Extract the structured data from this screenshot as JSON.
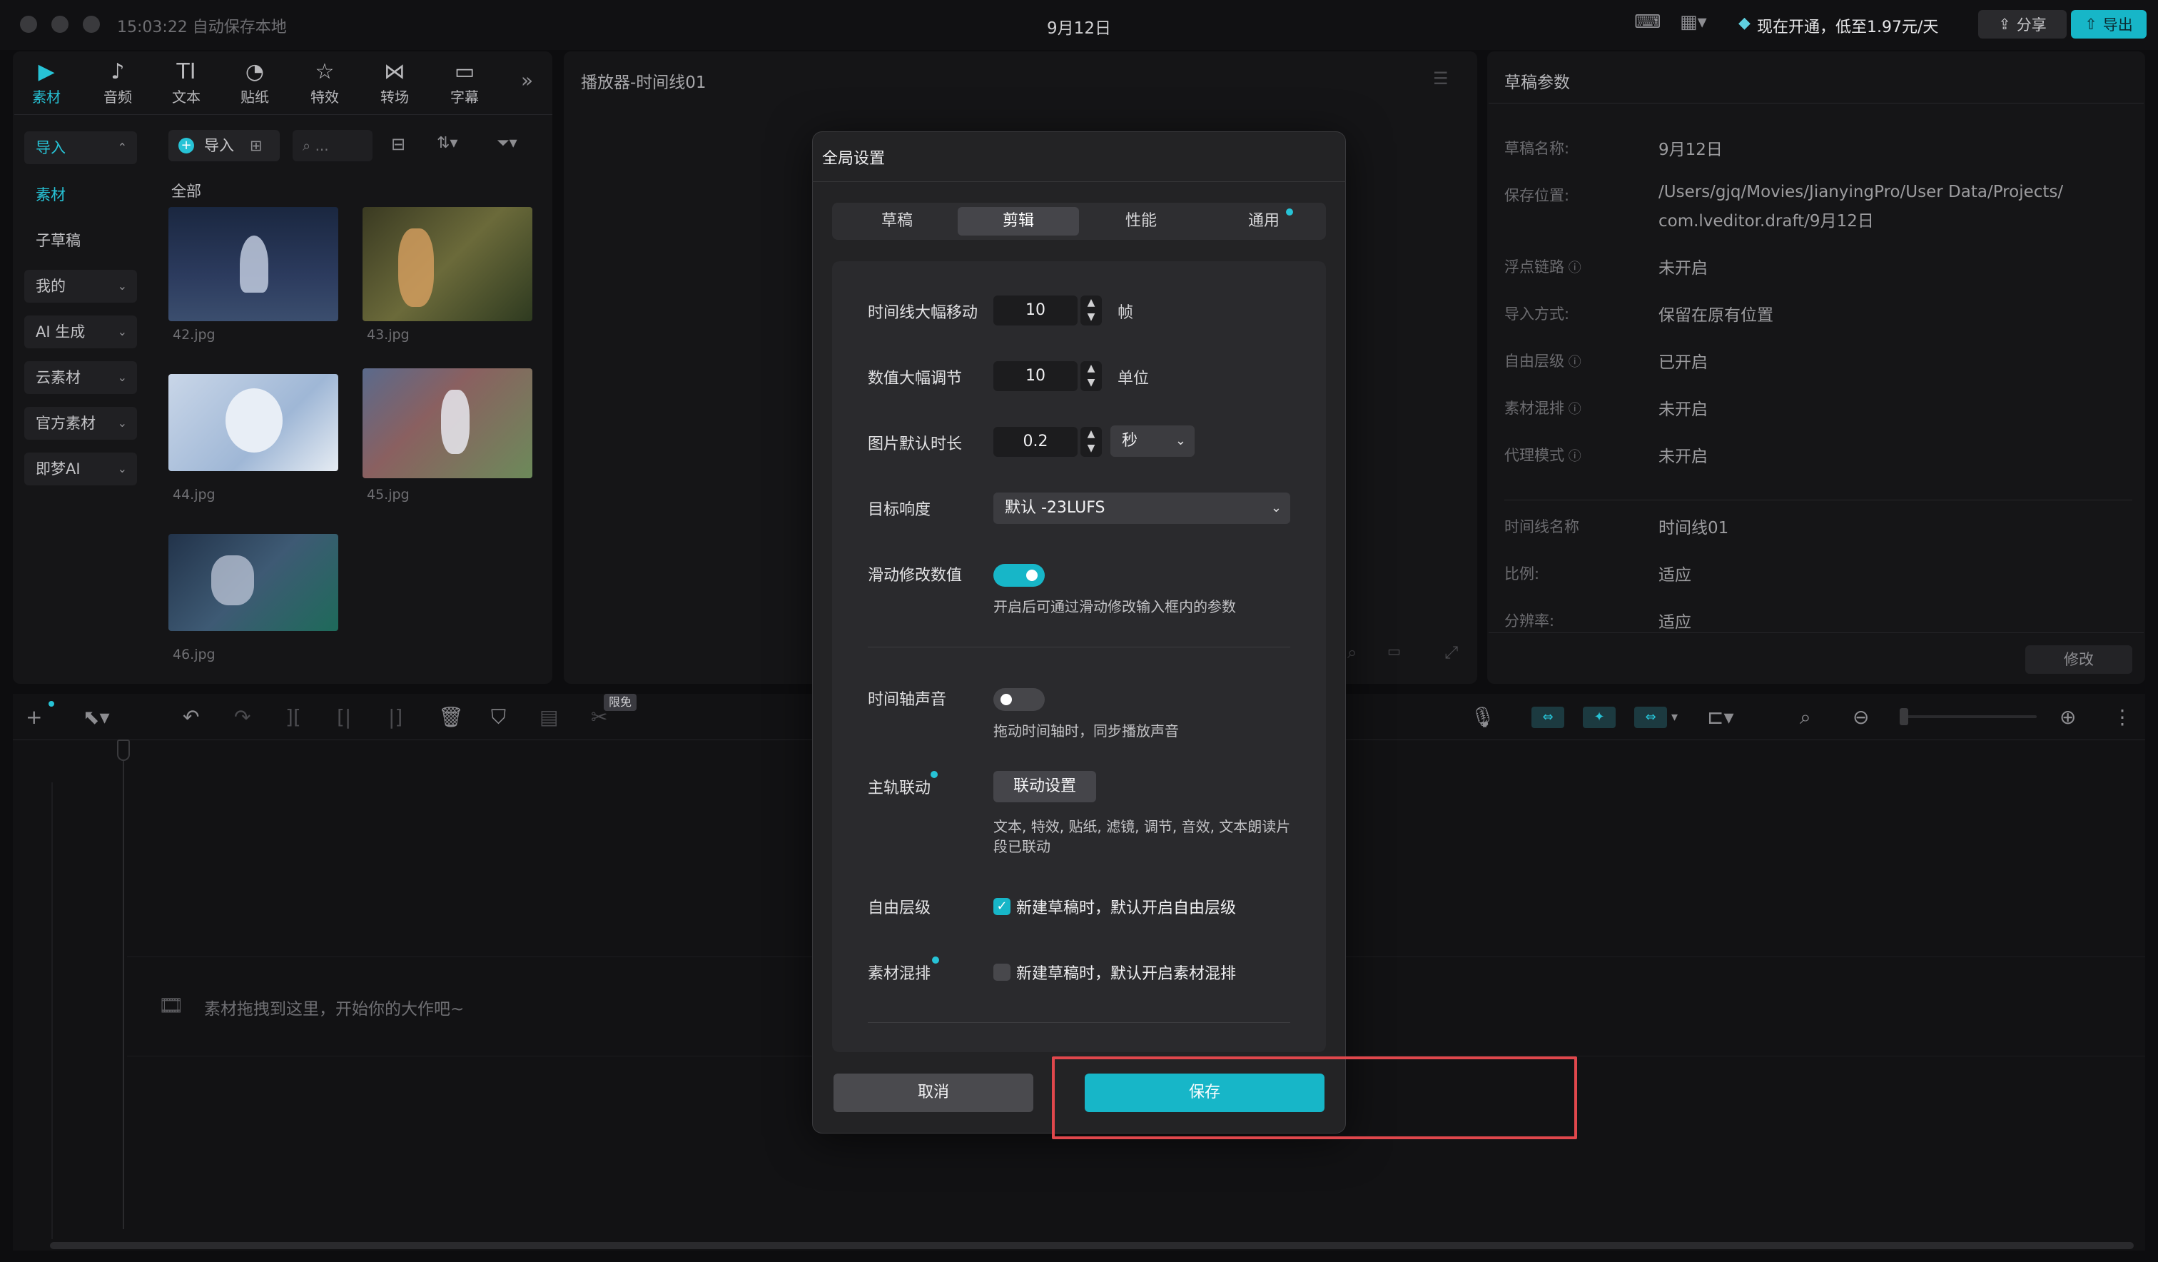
{
  "window": {
    "autosave": "15:03:22 自动保存本地",
    "title": "9月12日",
    "vip_text": "现在开通，低至1.97元/天",
    "share_label": "分享",
    "export_label": "导出"
  },
  "left_tabs": [
    {
      "label": "素材",
      "icon": "media-icon",
      "glyph": "▶"
    },
    {
      "label": "音频",
      "icon": "audio-icon",
      "glyph": "♪"
    },
    {
      "label": "文本",
      "icon": "text-icon",
      "glyph": "TI"
    },
    {
      "label": "贴纸",
      "icon": "sticker-icon",
      "glyph": "◔"
    },
    {
      "label": "特效",
      "icon": "effects-icon",
      "glyph": "☆"
    },
    {
      "label": "转场",
      "icon": "transition-icon",
      "glyph": "⋈"
    },
    {
      "label": "字幕",
      "icon": "subtitle-icon",
      "glyph": "▭"
    }
  ],
  "sidebar": {
    "items": [
      {
        "label": "导入"
      },
      {
        "label": "素材"
      },
      {
        "label": "子草稿"
      },
      {
        "label": "我的"
      },
      {
        "label": "AI 生成"
      },
      {
        "label": "云素材"
      },
      {
        "label": "官方素材"
      },
      {
        "label": "即梦AI"
      }
    ]
  },
  "media": {
    "import_label": "导入",
    "search_placeholder": "...",
    "all_label": "全部",
    "files": [
      "42.jpg",
      "43.jpg",
      "44.jpg",
      "45.jpg",
      "46.jpg"
    ]
  },
  "player": {
    "title": "播放器-时间线01"
  },
  "draft_params": {
    "title": "草稿参数",
    "rows": [
      {
        "label": "草稿名称:",
        "value": "9月12日"
      },
      {
        "label": "保存位置:",
        "value": "/Users/gjq/Movies/JianyingPro/User Data/Projects/",
        "value2": "com.lveditor.draft/9月12日"
      },
      {
        "label": "浮点链路",
        "value": "未开启"
      },
      {
        "label": "导入方式:",
        "value": "保留在原有位置"
      },
      {
        "label": "自由层级",
        "value": "已开启"
      },
      {
        "label": "素材混排",
        "value": "未开启"
      },
      {
        "label": "代理模式",
        "value": "未开启"
      },
      {
        "label": "时间线名称",
        "value": "时间线01"
      },
      {
        "label": "比例:",
        "value": "适应"
      },
      {
        "label": "分辨率:",
        "value": "适应"
      }
    ],
    "modify_label": "修改"
  },
  "timeline": {
    "free_badge": "限免",
    "drop_hint": "素材拖拽到这里，开始你的大作吧~"
  },
  "modal": {
    "title": "全局设置",
    "tabs": [
      "草稿",
      "剪辑",
      "性能",
      "通用"
    ],
    "active_tab": "剪辑",
    "rows": {
      "big_move": {
        "label": "时间线大幅移动",
        "value": "10",
        "unit": "帧"
      },
      "big_adjust": {
        "label": "数值大幅调节",
        "value": "10",
        "unit": "单位"
      },
      "img_duration": {
        "label": "图片默认时长",
        "value": "0.2",
        "unit_select": "秒"
      },
      "loudness": {
        "label": "目标响度",
        "select": "默认 -23LUFS"
      },
      "slide_modify": {
        "label": "滑动修改数值",
        "on": true,
        "desc": "开启后可通过滑动修改输入框内的参数"
      },
      "timeline_audio": {
        "label": "时间轴声音",
        "on": false,
        "desc": "拖动时间轴时，同步播放声音"
      },
      "main_link": {
        "label": "主轨联动",
        "button": "联动设置",
        "desc1": "文本, 特效, 贴纸, 滤镜, 调节, 音效, 文本朗读片",
        "desc2": "段已联动"
      },
      "free_layer": {
        "label": "自由层级",
        "checked": true,
        "text": "新建草稿时，默认开启自由层级"
      },
      "mix": {
        "label": "素材混排",
        "checked": false,
        "text": "新建草稿时，默认开启素材混排"
      }
    },
    "cancel_label": "取消",
    "save_label": "保存"
  },
  "colors": {
    "accent": "#17b6c8",
    "highlight": "#e0474c"
  }
}
